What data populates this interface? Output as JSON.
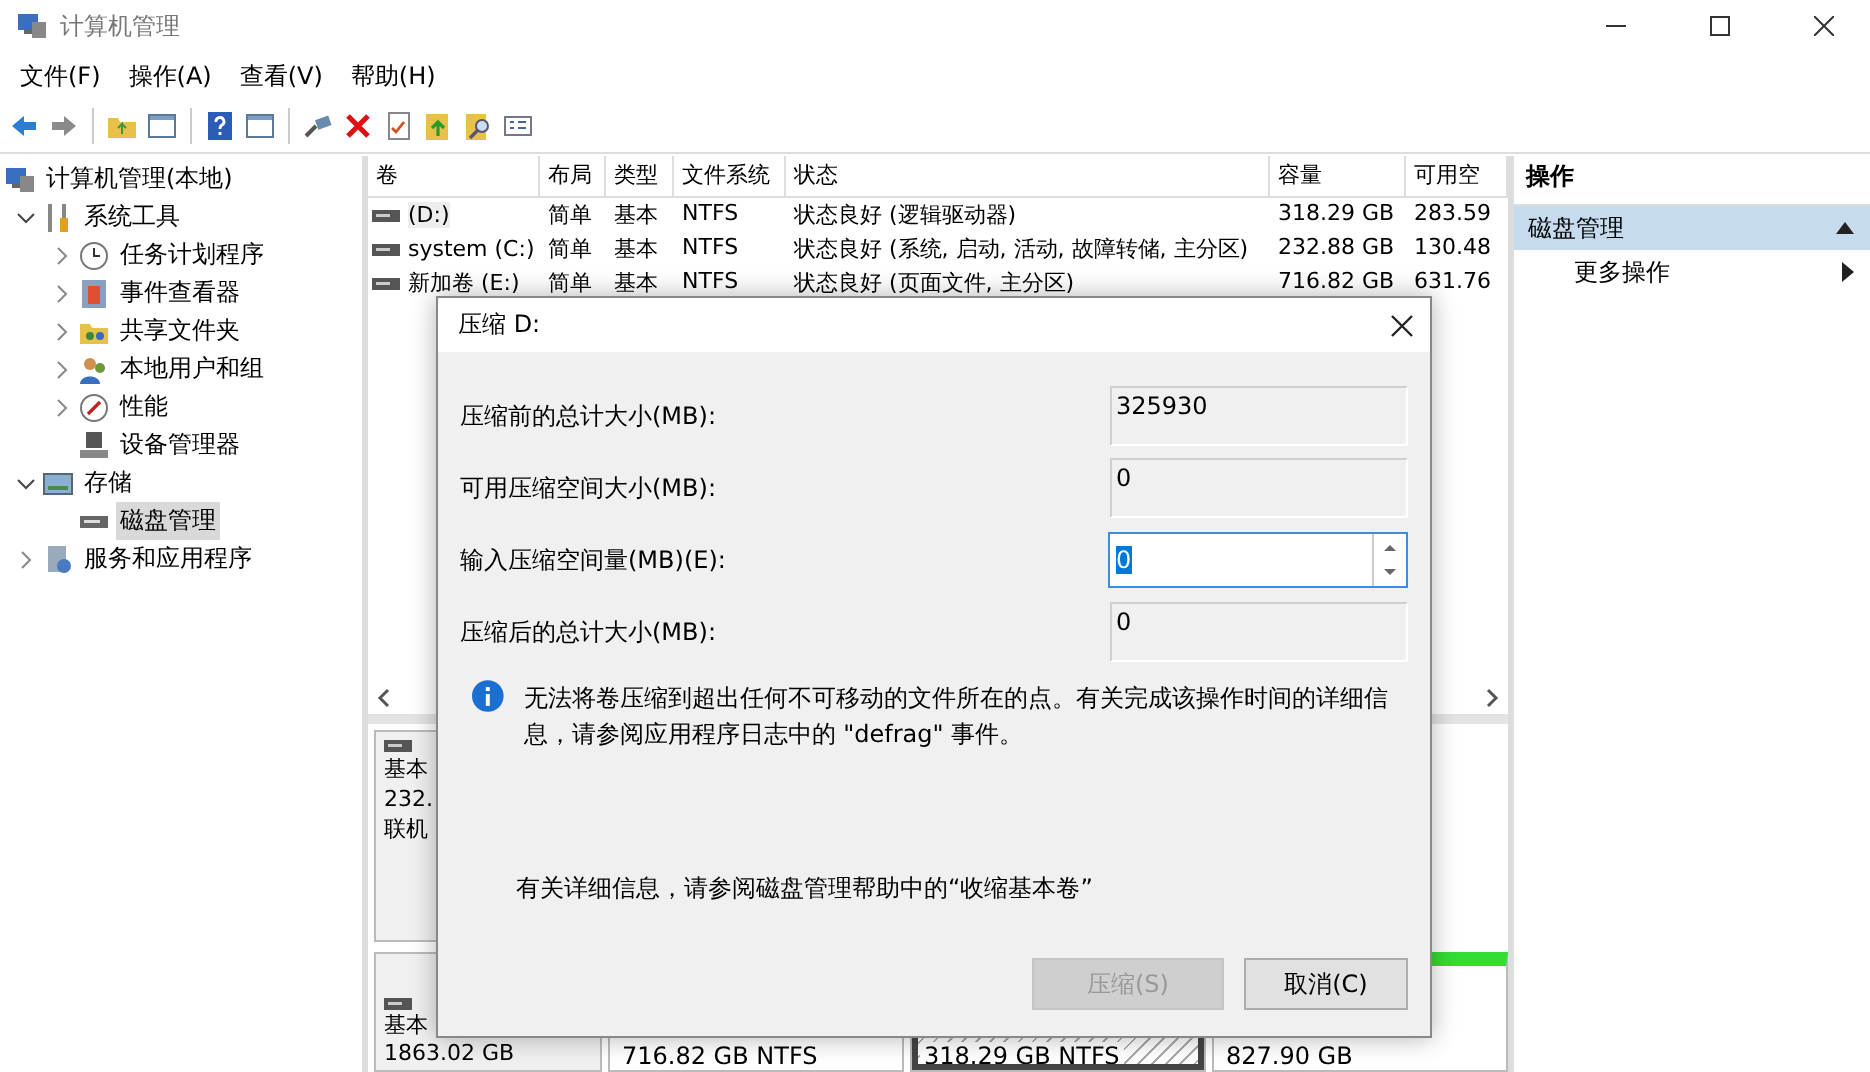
{
  "window": {
    "title": "计算机管理"
  },
  "menu": [
    "文件(F)",
    "操作(A)",
    "查看(V)",
    "帮助(H)"
  ],
  "toolbar": [
    {
      "kind": "back"
    },
    {
      "kind": "forward"
    },
    {
      "kind": "sep"
    },
    {
      "kind": "folder-up"
    },
    {
      "kind": "pane"
    },
    {
      "kind": "sep"
    },
    {
      "kind": "help"
    },
    {
      "kind": "pane"
    },
    {
      "kind": "sep"
    },
    {
      "kind": "connect"
    },
    {
      "kind": "delete"
    },
    {
      "kind": "doc"
    },
    {
      "kind": "folder-arrow"
    },
    {
      "kind": "folder-search"
    },
    {
      "kind": "props"
    }
  ],
  "tree": [
    {
      "label": "计算机管理(本地)",
      "kind": "computer",
      "selected": false,
      "children": [
        {
          "label": "系统工具",
          "kind": "tools",
          "expanded": true,
          "selected": false,
          "children": [
            {
              "label": "任务计划程序",
              "kind": "clock",
              "expanded": false,
              "selected": false
            },
            {
              "label": "事件查看器",
              "kind": "event",
              "expanded": false,
              "selected": false
            },
            {
              "label": "共享文件夹",
              "kind": "share",
              "expanded": false,
              "selected": false
            },
            {
              "label": "本地用户和组",
              "kind": "users",
              "expanded": false,
              "selected": false
            },
            {
              "label": "性能",
              "kind": "perf",
              "expanded": false,
              "selected": false
            },
            {
              "label": "设备管理器",
              "kind": "device",
              "selected": false
            }
          ]
        },
        {
          "label": "存储",
          "kind": "storage",
          "expanded": true,
          "selected": false,
          "children": [
            {
              "label": "磁盘管理",
              "kind": "disk",
              "selected": true
            }
          ]
        },
        {
          "label": "服务和应用程序",
          "kind": "services",
          "expanded": false,
          "selected": false
        }
      ]
    }
  ],
  "table": {
    "columns": [
      "卷",
      "布局",
      "类型",
      "文件系统",
      "状态",
      "容量",
      "可用空"
    ],
    "rows": [
      {
        "cells": [
          "(D:)",
          "简单",
          "基本",
          "NTFS",
          "状态良好 (逻辑驱动器)",
          "318.29 GB",
          "283.59"
        ],
        "selected": true
      },
      {
        "cells": [
          "system (C:)",
          "简单",
          "基本",
          "NTFS",
          "状态良好 (系统, 启动, 活动, 故障转储, 主分区)",
          "232.88 GB",
          "130.48"
        ],
        "selected": false
      },
      {
        "cells": [
          "新加卷 (E:)",
          "简单",
          "基本",
          "NTFS",
          "状态良好 (页面文件, 主分区)",
          "716.82 GB",
          "631.76"
        ],
        "selected": false
      }
    ]
  },
  "disks": [
    {
      "lines": [
        "基本",
        "232.",
        "联机"
      ]
    },
    {
      "lines": [
        "基本",
        "1863.02 GB"
      ],
      "partitions": [
        {
          "text": "716.82 GB NTFS",
          "kind": "primary",
          "selected": false
        },
        {
          "text": "318.29 GB NTFS",
          "kind": "logical",
          "selected": true
        },
        {
          "text": "827.90 GB",
          "kind": "free",
          "selected": false
        }
      ]
    }
  ],
  "actions": {
    "header": "操作",
    "section": {
      "label": "磁盘管理",
      "expanded": true
    },
    "items": [
      {
        "label": "更多操作"
      }
    ]
  },
  "dialog": {
    "title": "压缩 D:",
    "fields": [
      {
        "label": "压缩前的总计大小(MB):",
        "value": "325930",
        "kind": "readonly"
      },
      {
        "label": "可用压缩空间大小(MB):",
        "value": "0",
        "kind": "readonly"
      },
      {
        "label": "输入压缩空间量(MB)(E):",
        "value": "0",
        "kind": "spin"
      },
      {
        "label": "压缩后的总计大小(MB):",
        "value": "0",
        "kind": "readonly"
      }
    ],
    "info": "无法将卷压缩到超出任何不可移动的文件所在的点。有关完成该操作时间的详细信息，请参阅应用程序日志中的 \"defrag\" 事件。",
    "help": "有关详细信息，请参阅磁盘管理帮助中的“收缩基本卷”",
    "buttons": [
      {
        "label": "压缩(S)",
        "disabled": true
      },
      {
        "label": "取消(C)",
        "disabled": false
      }
    ]
  }
}
